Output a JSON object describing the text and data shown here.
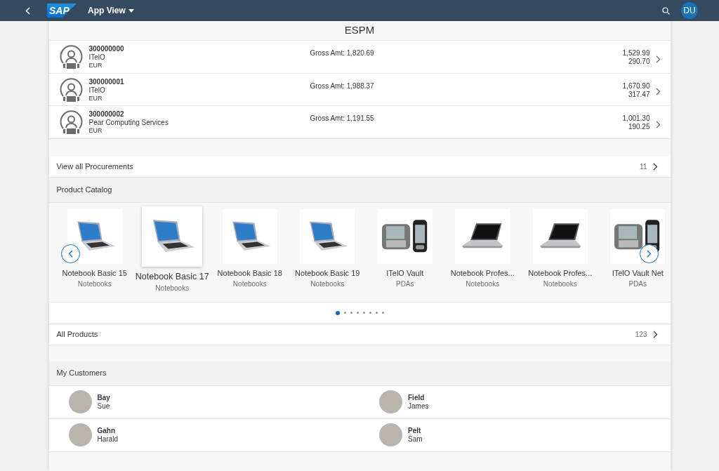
{
  "shell_bar": {
    "logo": "SAP",
    "title": "App View",
    "user_initials": "DU"
  },
  "page_title": "ESPM",
  "procurements": [
    {
      "id": "300000000",
      "supplier": "ITelO",
      "currency": "EUR",
      "gross": "Gross Amt: 1,820.69",
      "net": "1,529.99",
      "tax": "290.70"
    },
    {
      "id": "300000001",
      "supplier": "ITelO",
      "currency": "EUR",
      "gross": "Gross Amt: 1,988.37",
      "net": "1,670.90",
      "tax": "317.47"
    },
    {
      "id": "300000002",
      "supplier": "Pear Computing Services",
      "currency": "EUR",
      "gross": "Gross Amt: 1,191.55",
      "net": "1,001.30",
      "tax": "190.25"
    }
  ],
  "procurements_link": {
    "label": "View all Procurements",
    "count": "11"
  },
  "product_catalog": {
    "title": "Product Catalog",
    "products": [
      {
        "name": "Notebook Basic 15",
        "category": "Notebooks",
        "kind": "notebook",
        "selected": false
      },
      {
        "name": "Notebook Basic 17",
        "category": "Notebooks",
        "kind": "notebook",
        "selected": true
      },
      {
        "name": "Notebook Basic 18",
        "category": "Notebooks",
        "kind": "notebook",
        "selected": false
      },
      {
        "name": "Notebook Basic 19",
        "category": "Notebooks",
        "kind": "notebook",
        "selected": false
      },
      {
        "name": "ITelO Vault",
        "category": "PDAs",
        "kind": "pda",
        "selected": false
      },
      {
        "name": "Notebook Profes...",
        "category": "Notebooks",
        "kind": "notebook-dark",
        "selected": false
      },
      {
        "name": "Notebook Profes...",
        "category": "Notebooks",
        "kind": "notebook-dark",
        "selected": false
      },
      {
        "name": "ITelO Vault Net",
        "category": "PDAs",
        "kind": "pda",
        "selected": false
      }
    ],
    "pages": [
      {
        "selected": true
      },
      {
        "selected": false
      },
      {
        "selected": false
      },
      {
        "selected": false
      },
      {
        "selected": false
      },
      {
        "selected": false
      },
      {
        "selected": false
      },
      {
        "selected": false
      }
    ]
  },
  "products_link": {
    "label": "All Products",
    "count": "123"
  },
  "customers": {
    "title": "My Customers",
    "items": [
      {
        "last_name": "Bay",
        "first_name": "Sue"
      },
      {
        "last_name": "Field",
        "first_name": "James"
      },
      {
        "last_name": "Gahn",
        "first_name": "Harald"
      },
      {
        "last_name": "Pelt",
        "first_name": "Sam"
      }
    ]
  }
}
